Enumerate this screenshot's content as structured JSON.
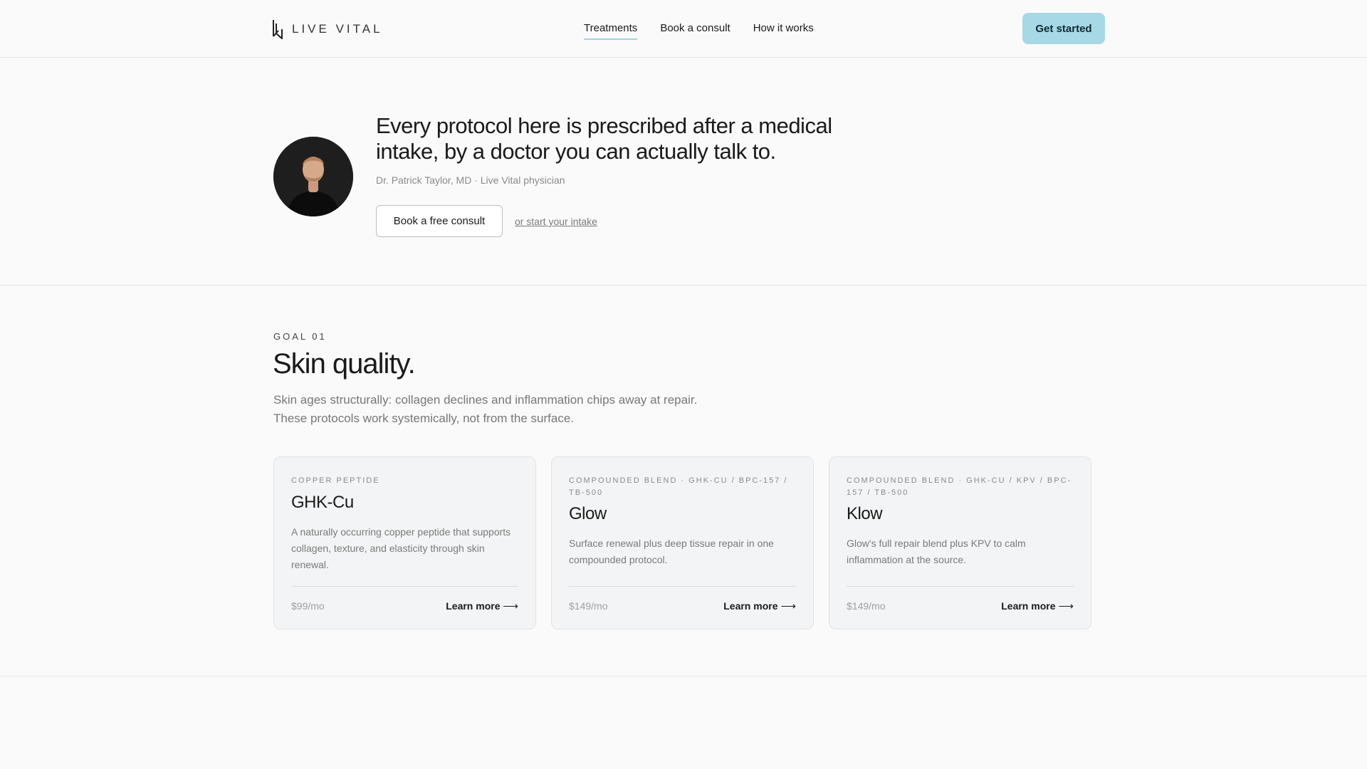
{
  "brand": {
    "name": "LIVE VITAL"
  },
  "nav": {
    "items": [
      {
        "label": "Treatments",
        "active": true
      },
      {
        "label": "Book a consult",
        "active": false
      },
      {
        "label": "How it works",
        "active": false
      }
    ],
    "cta_label": "Get started"
  },
  "hero": {
    "quote": "Every protocol here is prescribed after a medical intake, by a doctor you can actually talk to.",
    "attribution": "Dr. Patrick Taylor, MD · Live Vital physician",
    "primary_button": "Book a free consult",
    "secondary_link": "or start your intake"
  },
  "goal": {
    "eyebrow": "GOAL 01",
    "title": "Skin quality.",
    "description": "Skin ages structurally: collagen declines and inflammation chips away at repair. These protocols work systemically, not from the surface.",
    "cards": [
      {
        "label": "Copper peptide",
        "title": "GHK-Cu",
        "description": "A naturally occurring copper peptide that supports collagen, texture, and elasticity through skin renewal.",
        "price": "$99/mo",
        "link": "Learn more"
      },
      {
        "label": "Compounded blend · GHK-Cu / BPC-157 / TB-500",
        "title": "Glow",
        "description": "Surface renewal plus deep tissue repair in one compounded protocol.",
        "price": "$149/mo",
        "link": "Learn more"
      },
      {
        "label": "Compounded blend · GHK-Cu / KPV / BPC-157 / TB-500",
        "title": "Klow",
        "description": "Glow's full repair blend plus KPV to calm inflammation at the source.",
        "price": "$149/mo",
        "link": "Learn more"
      }
    ]
  },
  "colors": {
    "accent": "#a7d8e6",
    "nav_underline": "#9fd3e2",
    "background": "#fafafa",
    "card_bg": "#f3f4f5"
  }
}
